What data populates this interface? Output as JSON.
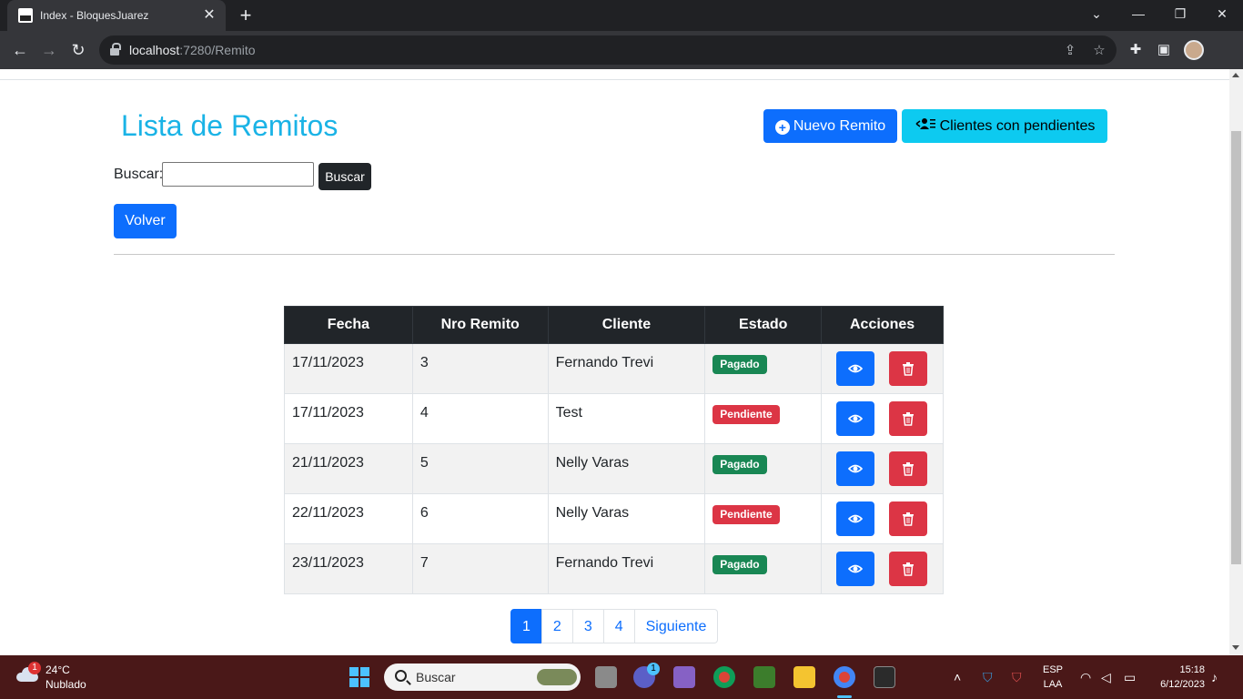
{
  "browser": {
    "tab_title": "Index - BloquesJuarez",
    "tab_close": "✕",
    "new_tab": "+",
    "url_host": "localhost",
    "url_path": ":7280/Remito",
    "window_controls": [
      "⌄",
      "—",
      "❐",
      "✕"
    ]
  },
  "page": {
    "title": "Lista de Remitos",
    "new_button": "Nuevo Remito",
    "clients_button": "Clientes con pendientes",
    "search_label": "Buscar:",
    "search_value": "",
    "search_button": "Buscar",
    "back_button": "Volver"
  },
  "table": {
    "headers": [
      "Fecha",
      "Nro Remito",
      "Cliente",
      "Estado",
      "Acciones"
    ],
    "rows": [
      {
        "fecha": "17/11/2023",
        "nro": "3",
        "cliente": "Fernando Trevi",
        "estado": "Pagado"
      },
      {
        "fecha": "17/11/2023",
        "nro": "4",
        "cliente": "Test",
        "estado": "Pendiente"
      },
      {
        "fecha": "21/11/2023",
        "nro": "5",
        "cliente": "Nelly Varas",
        "estado": "Pagado"
      },
      {
        "fecha": "22/11/2023",
        "nro": "6",
        "cliente": "Nelly Varas",
        "estado": "Pendiente"
      },
      {
        "fecha": "23/11/2023",
        "nro": "7",
        "cliente": "Fernando Trevi",
        "estado": "Pagado"
      }
    ],
    "status_colors": {
      "Pagado": "#198754",
      "Pendiente": "#dc3545"
    }
  },
  "pagination": {
    "pages": [
      "1",
      "2",
      "3",
      "4"
    ],
    "active": "1",
    "next": "Siguiente"
  },
  "taskbar": {
    "weather_badge": "1",
    "temperature": "24°C",
    "condition": "Nublado",
    "search_placeholder": "Buscar",
    "teams_badge": "1",
    "language": "ESP",
    "layout": "LAA",
    "time": "15:18",
    "date": "6/12/2023"
  },
  "colors": {
    "title": "#1ab3e6",
    "primary": "#0d6efd",
    "info": "#0dcaf0",
    "danger": "#dc3545",
    "success": "#198754",
    "taskbar": "#4a1818"
  }
}
